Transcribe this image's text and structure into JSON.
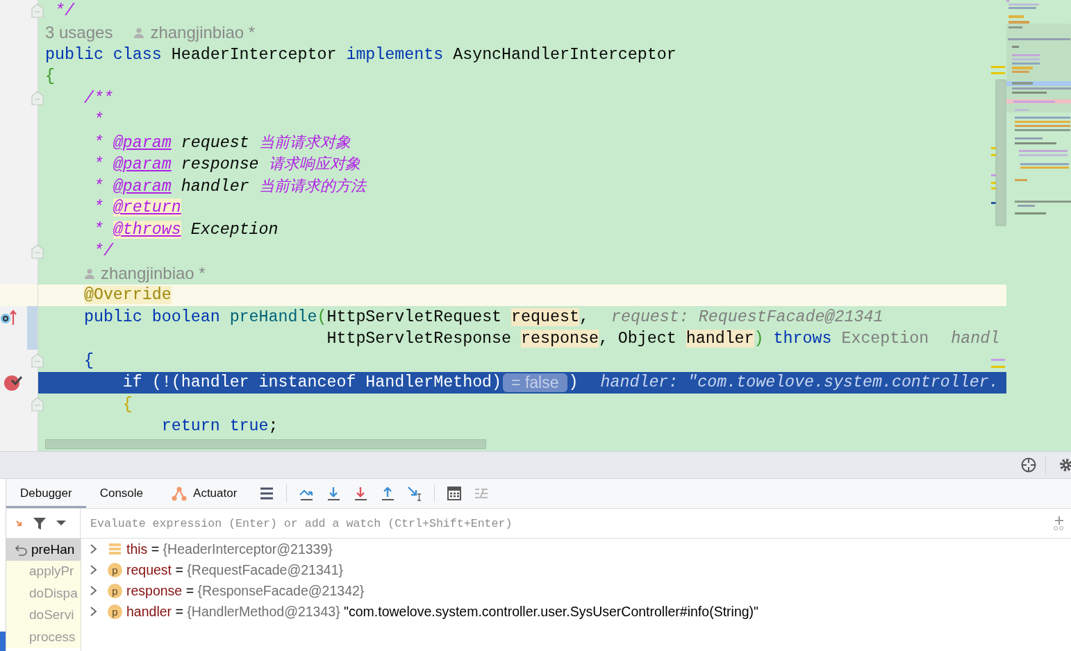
{
  "editor": {
    "lines": [
      {
        "kind": "code",
        "fold": true,
        "breakpoint": false,
        "overrides": false,
        "changed": false,
        "tokens": [
          {
            "text": " */",
            "kind": "doc"
          }
        ]
      },
      {
        "kind": "hint",
        "fold": false,
        "breakpoint": false,
        "overrides": false,
        "changed": false,
        "tokens": [
          {
            "text": "3 usages",
            "kind": "usages"
          },
          {
            "text": "zhangjinbiao *",
            "kind": "author"
          }
        ]
      },
      {
        "kind": "code",
        "fold": false,
        "breakpoint": false,
        "overrides": false,
        "changed": false,
        "tokens": [
          {
            "text": "public class ",
            "kind": "kw"
          },
          {
            "text": "HeaderInterceptor ",
            "kind": "plain"
          },
          {
            "text": "implements ",
            "kind": "kw"
          },
          {
            "text": "AsyncHandlerInterceptor",
            "kind": "plain"
          }
        ]
      },
      {
        "kind": "code",
        "fold": false,
        "breakpoint": false,
        "overrides": false,
        "changed": false,
        "tokens": [
          {
            "text": "{",
            "kind": "bgreen"
          }
        ]
      },
      {
        "kind": "code",
        "fold": true,
        "breakpoint": false,
        "overrides": false,
        "changed": false,
        "tokens": [
          {
            "text": "    /**",
            "kind": "doc"
          }
        ]
      },
      {
        "kind": "code",
        "fold": false,
        "breakpoint": false,
        "overrides": false,
        "changed": false,
        "tokens": [
          {
            "text": "     *",
            "kind": "doc"
          }
        ]
      },
      {
        "kind": "code",
        "fold": false,
        "breakpoint": false,
        "overrides": false,
        "changed": false,
        "tokens": [
          {
            "text": "     * ",
            "kind": "doc"
          },
          {
            "text": "@param",
            "kind": "doctag"
          },
          {
            "text": " request ",
            "kind": "docword"
          },
          {
            "text": "当前请求对象",
            "kind": "doccjk"
          }
        ]
      },
      {
        "kind": "code",
        "fold": false,
        "breakpoint": false,
        "overrides": false,
        "changed": false,
        "tokens": [
          {
            "text": "     * ",
            "kind": "doc"
          },
          {
            "text": "@param",
            "kind": "doctag"
          },
          {
            "text": " response ",
            "kind": "docword"
          },
          {
            "text": "请求响应对象",
            "kind": "doccjk"
          }
        ]
      },
      {
        "kind": "code",
        "fold": false,
        "breakpoint": false,
        "overrides": false,
        "changed": false,
        "tokens": [
          {
            "text": "     * ",
            "kind": "doc"
          },
          {
            "text": "@param",
            "kind": "doctag"
          },
          {
            "text": " handler ",
            "kind": "docword"
          },
          {
            "text": "当前请求的方法",
            "kind": "doccjk"
          }
        ]
      },
      {
        "kind": "code",
        "fold": false,
        "breakpoint": false,
        "overrides": false,
        "changed": false,
        "tokens": [
          {
            "text": "     * ",
            "kind": "doc"
          },
          {
            "text": "@return",
            "kind": "doctaghl"
          }
        ]
      },
      {
        "kind": "code",
        "fold": false,
        "breakpoint": false,
        "overrides": false,
        "changed": false,
        "tokens": [
          {
            "text": "     * ",
            "kind": "doc"
          },
          {
            "text": "@throws",
            "kind": "doctaghl"
          },
          {
            "text": " Exception",
            "kind": "docword"
          }
        ]
      },
      {
        "kind": "code",
        "fold": true,
        "breakpoint": false,
        "overrides": false,
        "changed": false,
        "tokens": [
          {
            "text": "     */",
            "kind": "doc"
          }
        ]
      },
      {
        "kind": "hint",
        "fold": false,
        "breakpoint": false,
        "overrides": false,
        "changed": false,
        "tokens": [
          {
            "text": "    zhangjinbiao *",
            "kind": "author"
          }
        ]
      },
      {
        "kind": "caret",
        "fold": false,
        "breakpoint": false,
        "overrides": false,
        "changed": false,
        "tokens": [
          {
            "text": "    @Override",
            "kind": "ann"
          }
        ]
      },
      {
        "kind": "code",
        "fold": false,
        "breakpoint": false,
        "overrides": true,
        "changed": true,
        "tokens": [
          {
            "text": "    public boolean ",
            "kind": "kw"
          },
          {
            "text": "preHandle",
            "kind": "method"
          },
          {
            "text": "(",
            "kind": "bgreen"
          },
          {
            "text": "HttpServletRequest ",
            "kind": "plain"
          },
          {
            "text": "request",
            "kind": "param"
          },
          {
            "text": ",",
            "kind": "plain"
          },
          {
            "text": "request: RequestFacade@21341",
            "kind": "inlay"
          }
        ]
      },
      {
        "kind": "code",
        "fold": false,
        "breakpoint": false,
        "overrides": false,
        "changed": true,
        "tokens": [
          {
            "text": "                             HttpServletResponse ",
            "kind": "plain"
          },
          {
            "text": "response",
            "kind": "param"
          },
          {
            "text": ", Object ",
            "kind": "plain"
          },
          {
            "text": "handler",
            "kind": "param"
          },
          {
            "text": ")",
            "kind": "bgreen"
          },
          {
            "text": " throws",
            "kind": "kw"
          },
          {
            "text": " Exception",
            "kind": "grey"
          },
          {
            "text": "handl",
            "kind": "inlay"
          }
        ]
      },
      {
        "kind": "code",
        "fold": true,
        "breakpoint": false,
        "overrides": false,
        "changed": false,
        "tokens": [
          {
            "text": "    {",
            "kind": "bblue"
          }
        ]
      },
      {
        "kind": "execution",
        "fold": false,
        "breakpoint": true,
        "overrides": false,
        "changed": false,
        "tokens": [
          {
            "text": "        if (!(handler instanceof HandlerMethod)",
            "kind": "plain"
          },
          {
            "text": "= false",
            "kind": "pill"
          },
          {
            "text": ")",
            "kind": "plain"
          },
          {
            "text": "handler: \"com.towelove.system.controller.",
            "kind": "inlay"
          }
        ]
      },
      {
        "kind": "code",
        "fold": true,
        "breakpoint": false,
        "overrides": false,
        "changed": false,
        "tokens": [
          {
            "text": "        {",
            "kind": "bgold"
          }
        ]
      },
      {
        "kind": "code",
        "fold": false,
        "breakpoint": false,
        "overrides": false,
        "changed": false,
        "tokens": [
          {
            "text": "            return true",
            "kind": "kw"
          },
          {
            "text": ";",
            "kind": "plain"
          }
        ]
      }
    ]
  },
  "debugger": {
    "tabs": [
      {
        "label": "Debugger",
        "selected": true,
        "kind": "plain"
      },
      {
        "label": "Console",
        "selected": false,
        "kind": "plain"
      },
      {
        "label": "Actuator",
        "selected": false,
        "kind": "actuator"
      }
    ],
    "watch": {
      "placeholder": "Evaluate expression (Enter) or add a watch (Ctrl+Shift+Enter)"
    },
    "frames": [
      {
        "label": "preHan",
        "selected": true
      },
      {
        "label": "applyPr",
        "selected": false
      },
      {
        "label": "doDispa",
        "selected": false
      },
      {
        "label": "doServi",
        "selected": false
      },
      {
        "label": "process",
        "selected": false
      }
    ],
    "variables": [
      {
        "kind": "this",
        "name": "this",
        "eq": "=",
        "value": "{HeaderInterceptor@21339}"
      },
      {
        "kind": "param",
        "badge": "p",
        "name": "request",
        "eq": "=",
        "value": "{RequestFacade@21341}"
      },
      {
        "kind": "param",
        "badge": "p",
        "name": "response",
        "eq": "=",
        "value": "{ResponseFacade@21342}"
      },
      {
        "kind": "param",
        "badge": "p",
        "name": "handler",
        "eq": "=",
        "value": "{HandlerMethod@21343}",
        "detail": "\"com.towelove.system.controller.user.SysUserController#info(String)\""
      }
    ]
  }
}
